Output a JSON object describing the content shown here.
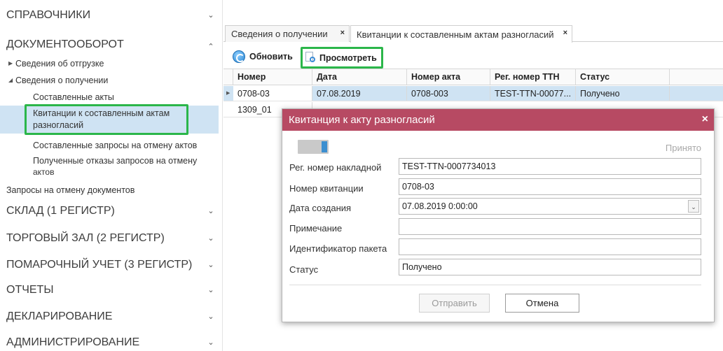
{
  "sidebar": {
    "sections": [
      {
        "label": "СПРАВОЧНИКИ",
        "chevron": "⌄"
      },
      {
        "label": "ДОКУМЕНТООБОРОТ",
        "chevron": "⌃"
      },
      {
        "label": "СКЛАД (1 РЕГИСТР)",
        "chevron": "⌄"
      },
      {
        "label": "ТОРГОВЫЙ ЗАЛ (2 РЕГИСТР)",
        "chevron": "⌄"
      },
      {
        "label": "ПОМАРОЧНЫЙ УЧЕТ (3 РЕГИСТР)",
        "chevron": "⌄"
      },
      {
        "label": "ОТЧЕТЫ",
        "chevron": "⌄"
      },
      {
        "label": "ДЕКЛАРИРОВАНИЕ",
        "chevron": "⌄"
      },
      {
        "label": "АДМИНИСТРИРОВАНИЕ",
        "chevron": "⌄"
      }
    ],
    "doc_items": {
      "shipments": "Сведения об отгрузке",
      "receipts": "Сведения о получении",
      "compiled_acts": "Составленные акты",
      "receipts_for_acts_line1": "Квитанции к составленным актам",
      "receipts_for_acts_line2": "разногласий",
      "cancel_requests": "Составленные запросы на отмену актов",
      "cancel_refusals_line1": "Полученные отказы запросов на отмену",
      "cancel_refusals_line2": "актов",
      "doc_cancel_requests": "Запросы на отмену документов"
    },
    "tri_right": "▶",
    "tri_down": "◢"
  },
  "tabs": [
    {
      "label": "Сведения о получении",
      "close": "×"
    },
    {
      "label": "Квитанции к составленным актам разногласий",
      "close": "×"
    }
  ],
  "toolbar": {
    "refresh_label": "Обновить",
    "view_label": "Просмотреть",
    "refresh_icon": "refresh-icon",
    "view_icon": "document-view-icon"
  },
  "grid": {
    "columns": [
      "Номер",
      "Дата",
      "Номер акта",
      "Рег. номер ТТН",
      "Статус"
    ],
    "rows": [
      {
        "number": "0708-03",
        "date": "07.08.2019",
        "act_number": "0708-003",
        "reg_number": "TEST-TTN-00077...",
        "status": "Получено"
      },
      {
        "number": "1309_01"
      }
    ],
    "row_marker": "▶"
  },
  "dialog": {
    "title": "Квитанция к акту разногласий",
    "close": "×",
    "state_label": "Принято",
    "fields": [
      {
        "label": "Рег. номер накладной",
        "value": "TEST-TTN-0007734013"
      },
      {
        "label": "Номер квитанции",
        "value": "0708-03"
      },
      {
        "label": "Дата создания",
        "value": "07.08.2019 0:00:00"
      },
      {
        "label": "Примечание",
        "value": ""
      },
      {
        "label": "Идентификатор пакета",
        "value": ""
      },
      {
        "label": "Статус",
        "value": "Получено"
      }
    ],
    "dropdown_glyph": "⌄",
    "send_label": "Отправить",
    "cancel_label": "Отмена"
  },
  "colors": {
    "dialog_header": "#b74a63",
    "highlight_frame": "#2bb64a",
    "selection": "#cfe3f3"
  }
}
